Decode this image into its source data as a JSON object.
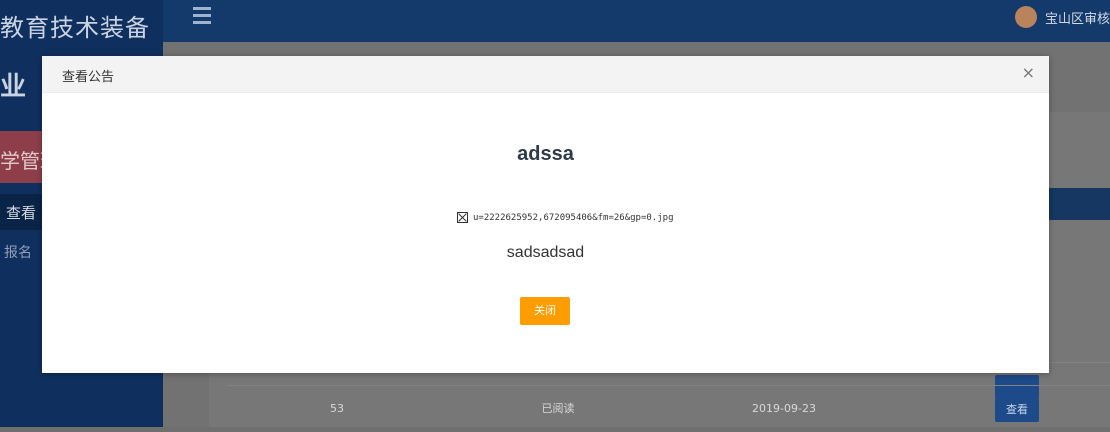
{
  "sidebar": {
    "brand_line1": "教育技术装备",
    "brand_line2": "业",
    "active_menu": "学管理",
    "sub_active": "查看",
    "sub_item": "报名"
  },
  "topbar": {
    "user_name": "宝山区审核"
  },
  "table": {
    "rows": [
      {
        "id": "",
        "status": "",
        "date": "",
        "action": ""
      },
      {
        "id": "53",
        "status": "已阅读",
        "date": "2019-09-23",
        "action": "查看"
      }
    ]
  },
  "modal": {
    "title": "查看公告",
    "close_icon": "×",
    "heading": "adssa",
    "image_alt": "u=2222625952,672095406&fm=26&gp=0.jpg",
    "body": "sadsadsad",
    "close_button": "关闭"
  }
}
